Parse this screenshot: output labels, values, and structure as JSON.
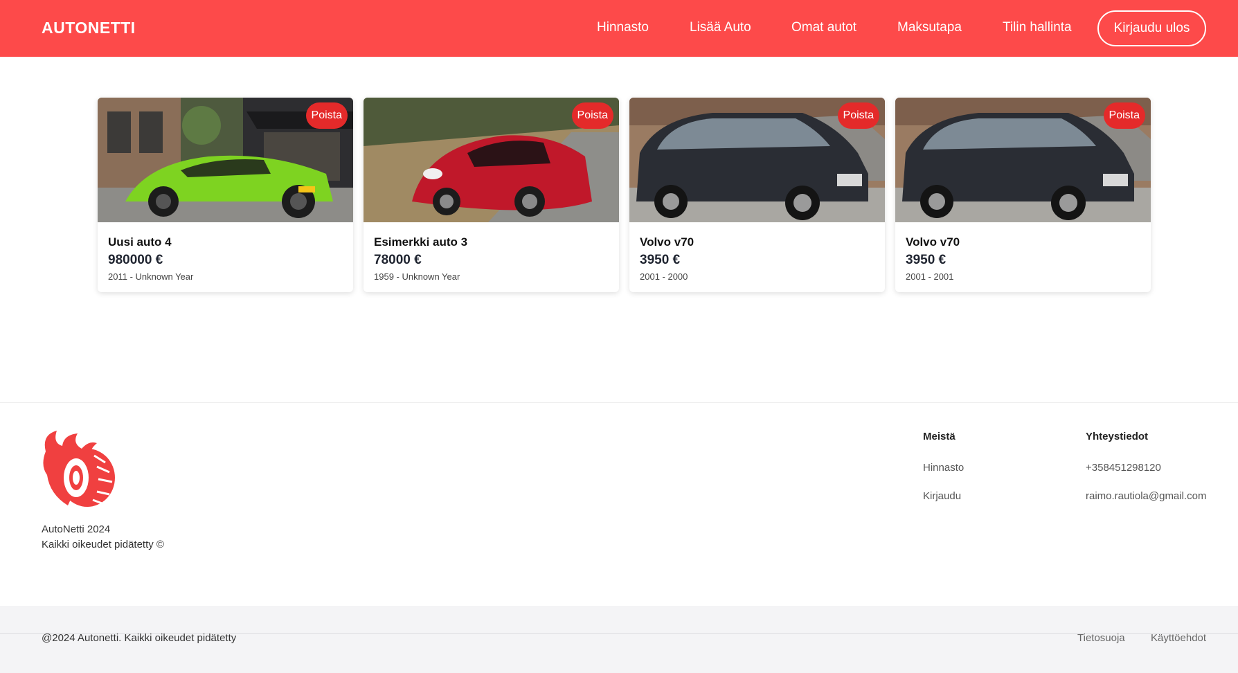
{
  "header": {
    "brand": "AUTONETTI",
    "accent_color": "#fd4a4a",
    "nav": [
      "Hinnasto",
      "Lisää Auto",
      "Omat autot",
      "Maksutapa",
      "Tilin hallinta"
    ],
    "logout_label": "Kirjaudu ulos"
  },
  "cars": [
    {
      "title": "Uusi auto 4",
      "price": "980000 €",
      "years": "2011 - Unknown Year",
      "delete_label": "Poista",
      "photo": "green-sports-car"
    },
    {
      "title": "Esimerkki auto 3",
      "price": "78000 €",
      "years": "1959 - Unknown Year",
      "delete_label": "Poista",
      "photo": "red-sports-car"
    },
    {
      "title": "Volvo v70",
      "price": "3950 €",
      "years": "2001 - 2000",
      "delete_label": "Poista",
      "photo": "dark-station-wagon"
    },
    {
      "title": "Volvo v70",
      "price": "3950 €",
      "years": "2001 - 2001",
      "delete_label": "Poista",
      "photo": "dark-station-wagon"
    }
  ],
  "footer": {
    "logo_icon": "flaming-tire-icon",
    "company_line": "AutoNetti 2024",
    "rights_line": "Kaikki oikeudet pidätetty ©",
    "about": {
      "heading": "Meistä",
      "links": [
        "Hinnasto",
        "Kirjaudu"
      ]
    },
    "contact": {
      "heading": "Yhteystiedot",
      "phone": "+358451298120",
      "email": "raimo.rautiola@gmail.com"
    }
  },
  "bottom": {
    "copyright": "@2024 Autonetti. Kaikki oikeudet pidätetty",
    "privacy": "Tietosuoja",
    "terms": "Käyttöehdot"
  }
}
